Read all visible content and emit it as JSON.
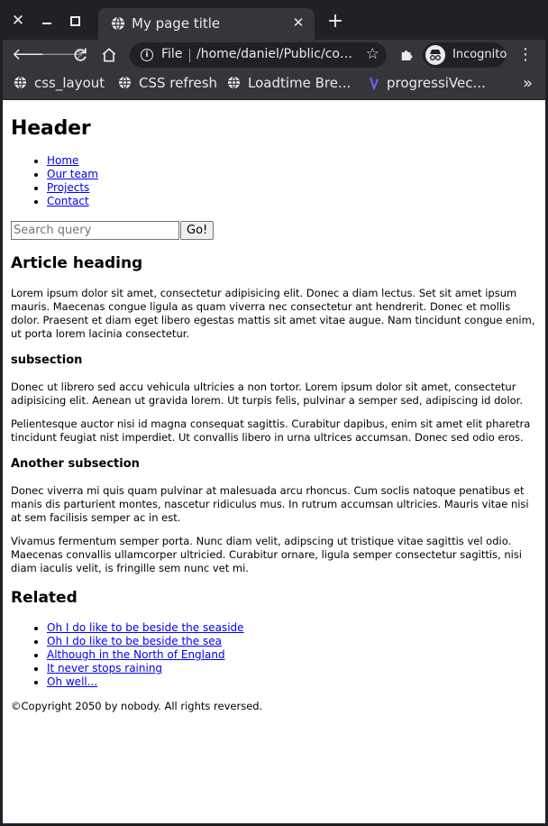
{
  "browser": {
    "tab_title": "My page title",
    "address_scheme": "File",
    "address_url": "/home/daniel/Public/content/index.html",
    "profile_label": "Incognito",
    "new_tab_glyph": "+",
    "bookmarks": [
      {
        "label": "css_layout",
        "icon": "globe-icon"
      },
      {
        "label": "CSS refresh",
        "icon": "globe-icon"
      },
      {
        "label": "Loadtime Bre...",
        "icon": "globe-icon"
      },
      {
        "label": "progressiVec...",
        "icon": "progressive-logo-icon"
      }
    ],
    "bookmarks_more_glyph": "»"
  },
  "page": {
    "header": "Header",
    "nav": [
      "Home",
      "Our team",
      "Projects",
      "Contact"
    ],
    "search": {
      "placeholder": "Search query",
      "button_label": "Go!"
    },
    "article_heading": "Article heading",
    "para1": "Lorem ipsum dolor sit amet, consectetur adipisicing elit. Donec a diam lectus. Set sit amet ipsum mauris. Maecenas congue ligula as quam viverra nec consectetur ant hendrerit. Donec et mollis dolor. Praesent et diam eget libero egestas mattis sit amet vitae augue. Nam tincidunt congue enim, ut porta lorem lacinia consectetur.",
    "subsection1": "subsection",
    "para2": "Donec ut librero sed accu vehicula ultricies a non tortor. Lorem ipsum dolor sit amet, consectetur adipisicing elit. Aenean ut gravida lorem. Ut turpis felis, pulvinar a semper sed, adipiscing id dolor.",
    "para3": "Pelientesque auctor nisi id magna consequat sagittis. Curabitur dapibus, enim sit amet elit pharetra tincidunt feugiat nist imperdiet. Ut convallis libero in urna ultrices accumsan. Donec sed odio eros.",
    "subsection2": "Another subsection",
    "para4": "Donec viverra mi quis quam pulvinar at malesuada arcu rhoncus. Cum soclis natoque penatibus et manis dis parturient montes, nascetur ridiculus mus. In rutrum accumsan ultricies. Mauris vitae nisi at sem facilisis semper ac in est.",
    "para5": "Vivamus fermentum semper porta. Nunc diam velit, adipscing ut tristique vitae sagittis vel odio. Maecenas convallis ullamcorper ultricied. Curabitur ornare, ligula semper consectetur sagittis, nisi diam iaculis velit, is fringille sem nunc vet mi.",
    "related_heading": "Related",
    "related_links": [
      "Oh I do like to be beside the seaside",
      "Oh I do like to be beside the sea",
      "Although in the North of England",
      "It never stops raining",
      "Oh well..."
    ],
    "footer": "©Copyright 2050 by nobody. All rights reversed."
  }
}
